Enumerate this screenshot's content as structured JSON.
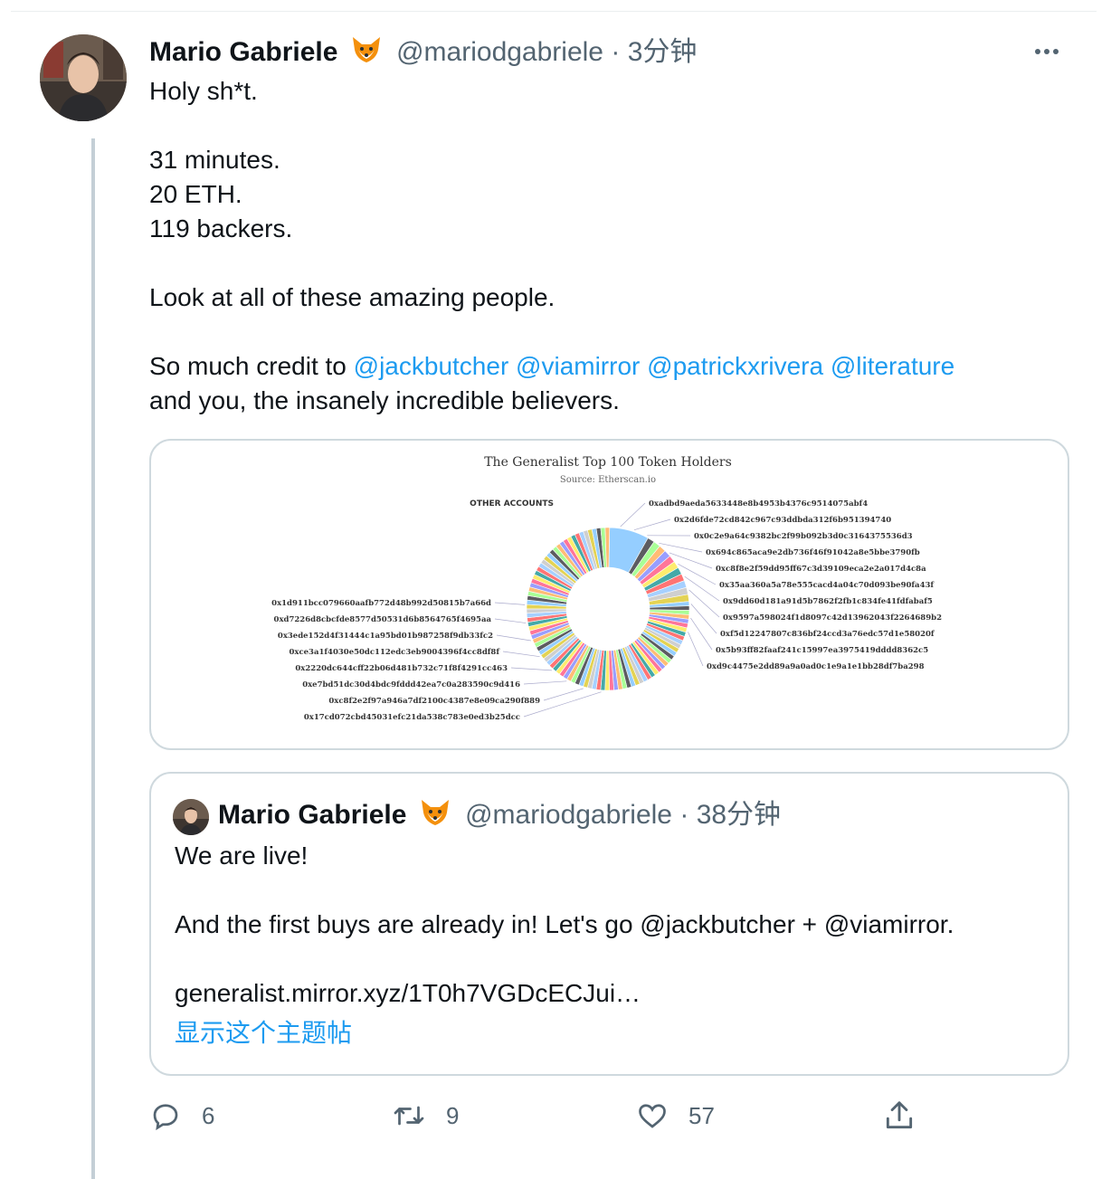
{
  "tweet": {
    "author_name": "Mario Gabriele",
    "author_handle": "@mariodgabriele",
    "separator": "·",
    "time": "3分钟",
    "lines": [
      "Holy sh*t.",
      "",
      "31 minutes.",
      "20 ETH.",
      "119 backers.",
      "",
      "Look at all of these amazing people.",
      ""
    ],
    "credit_prefix": "So much credit to",
    "mentions": [
      "@jackbutcher",
      "@viamirror",
      "@patrickxrivera",
      "@literature"
    ],
    "credit_suffix": "and you, the insanely incredible believers."
  },
  "chart_data": {
    "type": "pie",
    "title": "The Generalist Top 100 Token Holders",
    "subtitle": "Source: Etherscan.io",
    "legend_other": "OTHER ACCOUNTS",
    "labels_right": [
      "0xadbd9aeda5633448e8b4953b4376c9514075abf4",
      "0x2d6fde72cd842c967c93ddbda312f6b951394740",
      "0x0c2e9a64c9382bc2f99b092b3d0c3164375536d3",
      "0x694c865aca9e2db736f46f91042a8e5bbe3790fb",
      "0xc8f8e2f59dd95ff67c3d39109eca2e2a017d4c8a",
      "0x35aa360a5a78e555cacd4a04c70d093be90fa43f",
      "0x9dd60d181a91d5b7862f2fb1c834fe41fdfabaf5",
      "0x9597a598024f1d8097c42d13962043f2264689b2",
      "0xf5d12247807c836bf24ccd3a76edc57d1e58020f",
      "0x5b93ff82faaf241c15997ea3975419dddd8362c5",
      "0xd9c4475e2dd89a9a0ad0c1e9a1e1bb28df7ba298"
    ],
    "labels_left": [
      "0x1d911bcc079660aafb772d48b992d50815b7a66d",
      "0xd7226d8cbcfde8577d50531d6b8564765f4695aa",
      "0x3ede152d4f31444c1a95bd01b987258f9db33fc2",
      "0xce3a1f4030e50dc112edc3eb9004396f4cc8df8f",
      "0x2220dc644cff22b06d481b732c71f8f4291cc463",
      "0xe7bd51dc30d4bdc9fddd42ea7c0a283590c9d416",
      "0xc8f2e2f97a946a7df2100c4387e8e09ca290f889",
      "0x17cd072cbd45031efc21da538c783e0ed3b25dcc"
    ],
    "palette": [
      "#95ceff",
      "#5c5c61",
      "#a9ff96",
      "#ffbc75",
      "#999eff",
      "#ff7599",
      "#fdec6d",
      "#44a9a8",
      "#ff7474",
      "#a6d0ff",
      "#cfcfcf",
      "#e4d354"
    ]
  },
  "quote": {
    "author_name": "Mario Gabriele",
    "author_handle": "@mariodgabriele",
    "separator": "·",
    "time": "38分钟",
    "line1": "We are live!",
    "line2": "",
    "line3": "And the first buys are already in! Let's go @jackbutcher + @viamirror.",
    "line4": "",
    "line5": "generalist.mirror.xyz/1T0h7VGDcECJui…",
    "show_thread": "显示这个主题帖"
  },
  "actions": {
    "replies": "6",
    "retweets": "9",
    "likes": "57"
  },
  "colors": {
    "link": "#1d9bf0",
    "muted": "#536471",
    "border": "#cfd9de"
  }
}
